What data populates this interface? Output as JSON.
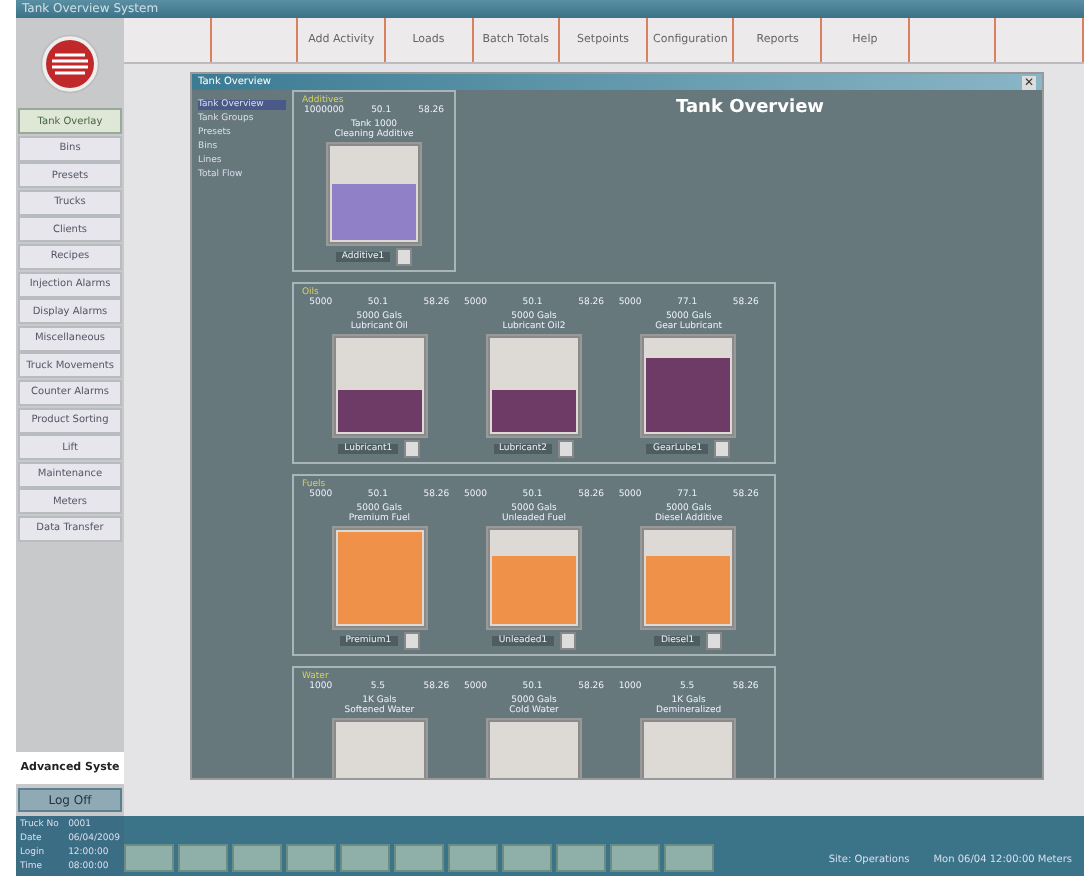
{
  "window": {
    "title": "Tank Overview System"
  },
  "menu": [
    {
      "selected": false
    },
    {
      "selected": false
    },
    {
      "label": "Add Activity",
      "selected": false
    },
    {
      "label": "Loads",
      "selected": false
    },
    {
      "label": "Batch Totals",
      "selected": false
    },
    {
      "label": "Setpoints",
      "selected": false
    },
    {
      "label": "Configuration",
      "selected": false
    },
    {
      "label": "Reports",
      "selected": false
    },
    {
      "label": "Help",
      "selected": false
    },
    {
      "selected": false
    },
    {
      "selected": false
    }
  ],
  "sidebar": {
    "items": [
      {
        "label": "Tank Overlay",
        "selected": true
      },
      {
        "label": "Bins",
        "selected": false
      },
      {
        "label": "Presets",
        "selected": false
      },
      {
        "label": "Trucks",
        "selected": false
      },
      {
        "label": "Clients",
        "selected": false
      },
      {
        "label": "Recipes",
        "selected": false
      },
      {
        "label": "Injection Alarms",
        "selected": false
      },
      {
        "label": "Display Alarms",
        "selected": false
      },
      {
        "label": "Miscellaneous",
        "selected": false
      },
      {
        "label": "Truck Movements",
        "selected": false
      },
      {
        "label": "Counter Alarms",
        "selected": false
      },
      {
        "label": "Product Sorting",
        "selected": false
      },
      {
        "label": "Lift",
        "selected": false
      },
      {
        "label": "Maintenance",
        "selected": false
      },
      {
        "label": "Meters",
        "selected": false
      },
      {
        "label": "Data Transfer",
        "selected": false
      }
    ],
    "brand": "Advanced Syste",
    "logoff": "Log Off",
    "info": [
      [
        "Truck No",
        "0001"
      ],
      [
        "Date",
        "06/04/2009"
      ],
      [
        "Login",
        "12:00:00"
      ],
      [
        "Time",
        "08:00:00"
      ]
    ]
  },
  "panel": {
    "title": "Tank Overview",
    "window_title": "Tank Overview",
    "close": "✕",
    "list": [
      {
        "label": "Tank Overview",
        "selected": true
      },
      {
        "label": "Tank Groups",
        "selected": false
      },
      {
        "label": "Presets",
        "selected": false
      },
      {
        "label": "Bins",
        "selected": false
      },
      {
        "label": "Lines",
        "selected": false
      },
      {
        "label": "Total Flow",
        "selected": false
      }
    ],
    "groups": [
      {
        "label": "Additives",
        "color": "#8f80c8",
        "tanks": [
          {
            "head": [
              "1000000",
              "50.1",
              "58.26"
            ],
            "name": [
              "Tank 1000",
              "Cleaning Additive"
            ],
            "level": 0.6,
            "foot": "Additive1"
          }
        ]
      },
      {
        "label": "Oils",
        "color": "#6e3a66",
        "tanks": [
          {
            "head": [
              "5000",
              "50.1",
              "58.26"
            ],
            "name": [
              "5000 Gals",
              "Lubricant Oil"
            ],
            "level": 0.45,
            "foot": "Lubricant1"
          },
          {
            "head": [
              "5000",
              "50.1",
              "58.26"
            ],
            "name": [
              "5000 Gals",
              "Lubricant Oil2"
            ],
            "level": 0.45,
            "foot": "Lubricant2"
          },
          {
            "head": [
              "5000",
              "77.1",
              "58.26"
            ],
            "name": [
              "5000 Gals",
              "Gear Lubricant"
            ],
            "level": 0.8,
            "foot": "GearLube1"
          }
        ]
      },
      {
        "label": "Fuels",
        "color": "#f0914a",
        "tanks": [
          {
            "head": [
              "5000",
              "50.1",
              "58.26"
            ],
            "name": [
              "5000 Gals",
              "Premium Fuel"
            ],
            "level": 1,
            "foot": "Premium1"
          },
          {
            "head": [
              "5000",
              "50.1",
              "58.26"
            ],
            "name": [
              "5000 Gals",
              "Unleaded Fuel"
            ],
            "level": 0.75,
            "foot": "Unleaded1"
          },
          {
            "head": [
              "5000",
              "77.1",
              "58.26"
            ],
            "name": [
              "5000 Gals",
              "Diesel Additive"
            ],
            "level": 0.75,
            "foot": "Diesel1"
          }
        ]
      },
      {
        "label": "Water",
        "tanks": [
          {
            "head": [
              "1000",
              "5.5",
              "58.26"
            ],
            "name": [
              "1K Gals",
              "Softened Water"
            ]
          },
          {
            "head": [
              "5000",
              "50.1",
              "58.26"
            ],
            "name": [
              "5000 Gals",
              "Cold Water"
            ]
          },
          {
            "head": [
              "1000",
              "5.5",
              "58.26"
            ],
            "name": [
              "1K Gals",
              "Demineralized"
            ]
          }
        ]
      }
    ]
  },
  "status_bar": {
    "texts": [
      "Site: Operations",
      "Mon 06/04 12:00:00 Meters"
    ]
  }
}
